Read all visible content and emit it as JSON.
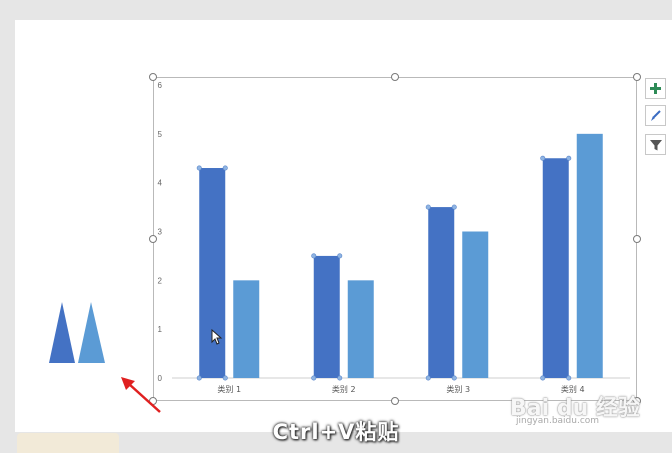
{
  "caption": "Ctrl+V粘贴",
  "watermark": {
    "main": "Bai du 经验",
    "sub": "jingyan.baidu.com"
  },
  "side_buttons": [
    {
      "icon": "plus-icon",
      "color": "#2e8b57"
    },
    {
      "icon": "brush-icon",
      "color": "#3b6cc2"
    },
    {
      "icon": "filter-icon",
      "color": "#555555"
    }
  ],
  "colors": {
    "series1": "#4472c4",
    "series2": "#5b9bd5",
    "arrow": "#e02020"
  },
  "chart_data": {
    "type": "bar",
    "categories": [
      "类别 1",
      "类别 2",
      "类别 3",
      "类别 4"
    ],
    "series": [
      {
        "values": [
          4.3,
          2.5,
          3.5,
          4.5
        ]
      },
      {
        "values": [
          2,
          2,
          3,
          5
        ]
      }
    ],
    "yticks": [
      "0",
      "1",
      "2",
      "3",
      "4",
      "5",
      "6"
    ],
    "ylim": [
      0,
      6
    ],
    "grid": false,
    "selected_series": 0
  }
}
